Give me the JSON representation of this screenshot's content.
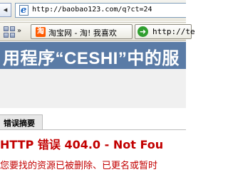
{
  "browser": {
    "back_glyph": "◂",
    "address_url": "http://baobao123.com/q?ct=24",
    "page_icon_glyph": "e"
  },
  "favorites": {
    "menu_glyph": "»",
    "tab1": {
      "icon_glyph": "淘",
      "label": "淘宝网 - 淘! 我喜欢",
      "icon_color": "#ff5a00"
    },
    "tab2": {
      "icon_glyph": "➜",
      "label": "http://te",
      "icon_color": "#2f9e2f"
    }
  },
  "page": {
    "banner_title": "用程序“CESHI”中的服",
    "summary_label": "错误摘要",
    "error_title": "HTTP 错误 404.0 - Not Fou",
    "error_description": "您要找的资源已被删除、已更名或暂时"
  },
  "colors": {
    "banner_bg": "#5a7ba6",
    "error_red": "#c20000"
  }
}
